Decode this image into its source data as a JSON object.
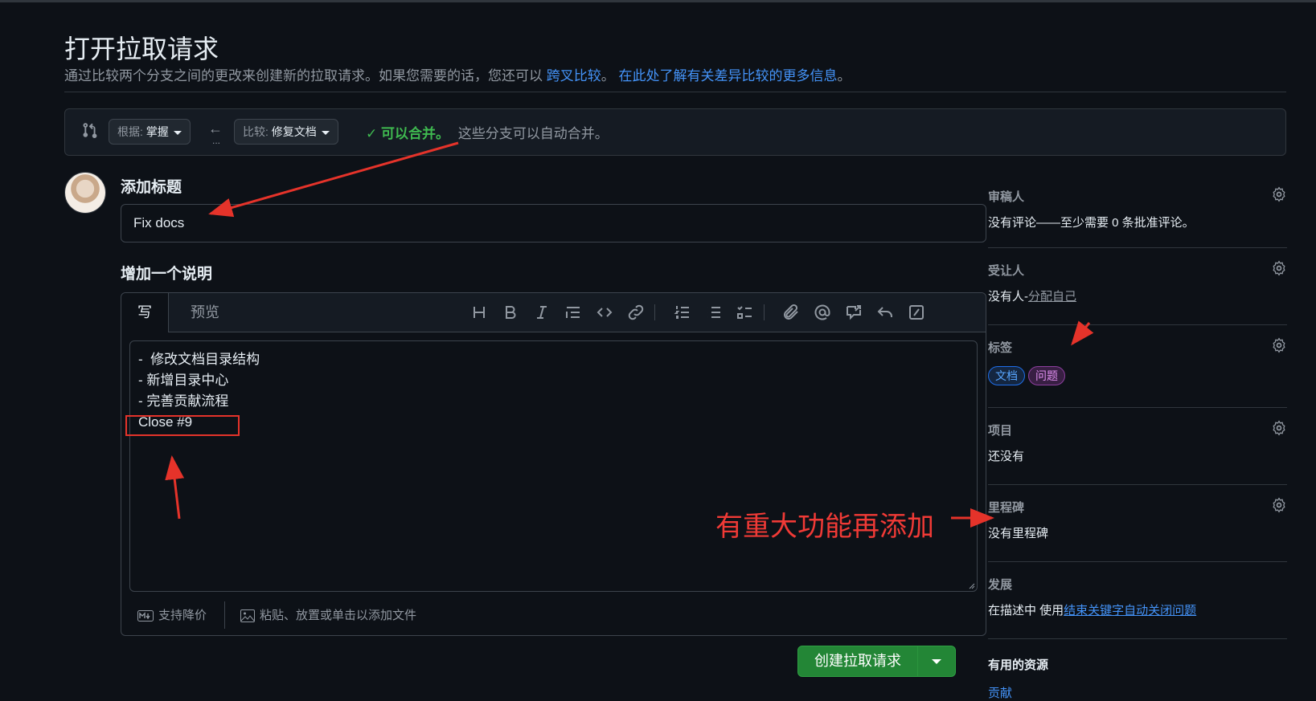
{
  "header": {
    "title": "打开拉取请求",
    "subtitle_text": "通过比较两个分支之间的更改来创建新的拉取请求。如果您需要的话，您还可以",
    "cross_compare_link": "跨叉比较",
    "sep": "。",
    "learn_more_link": "在此处了解有关差异比较的更多信息",
    "end": "。"
  },
  "compare": {
    "base_label": "根据:",
    "base_branch": "掌握",
    "compare_label": "比较:",
    "compare_branch": "修复文档",
    "dots": "...",
    "merge_status": "可以合并。",
    "merge_desc": "这些分支可以自动合并。"
  },
  "form": {
    "title_label": "添加标题",
    "title_value": "Fix docs",
    "desc_label": "增加一个说明",
    "tab_write": "写",
    "tab_preview": "预览",
    "body_lines": [
      "-  修改文档目录结构",
      "- 新增目录中心",
      "- 完善贡献流程",
      "Close #9"
    ],
    "markdown_note": "支持降价",
    "attach_note": "粘贴、放置或单击以添加文件",
    "create_button": "创建拉取请求"
  },
  "toolbar_icons": [
    "heading-icon",
    "bold-icon",
    "italic-icon",
    "quote-icon",
    "code-icon",
    "link-icon",
    "ordered-list-icon",
    "unordered-list-icon",
    "task-list-icon",
    "attach-icon",
    "mention-icon",
    "reference-icon",
    "reply-icon",
    "slash-command-icon"
  ],
  "sidebar": {
    "reviewers": {
      "title": "审稿人",
      "value": "没有评论——至少需要 0 条批准评论。"
    },
    "assignees": {
      "title": "受让人",
      "value_prefix": "没有人-",
      "value_link": "分配自己"
    },
    "labels": {
      "title": "标签",
      "items": [
        "文档",
        "问题"
      ]
    },
    "projects": {
      "title": "项目",
      "value": "还没有"
    },
    "milestone": {
      "title": "里程碑",
      "value": "没有里程碑"
    },
    "development": {
      "title": "发展",
      "value_prefix": "在描述中 使用",
      "value_link": "结束关键字自动关闭问题"
    },
    "resources": {
      "title": "有用的资源",
      "link": "贡献"
    }
  },
  "annotation": {
    "text": "有重大功能再添加"
  },
  "colors": {
    "background": "#0d1117",
    "accent_blue": "#4493f8",
    "success_green": "#3fb950",
    "button_green": "#238636",
    "annotation_red": "#f03a36"
  }
}
